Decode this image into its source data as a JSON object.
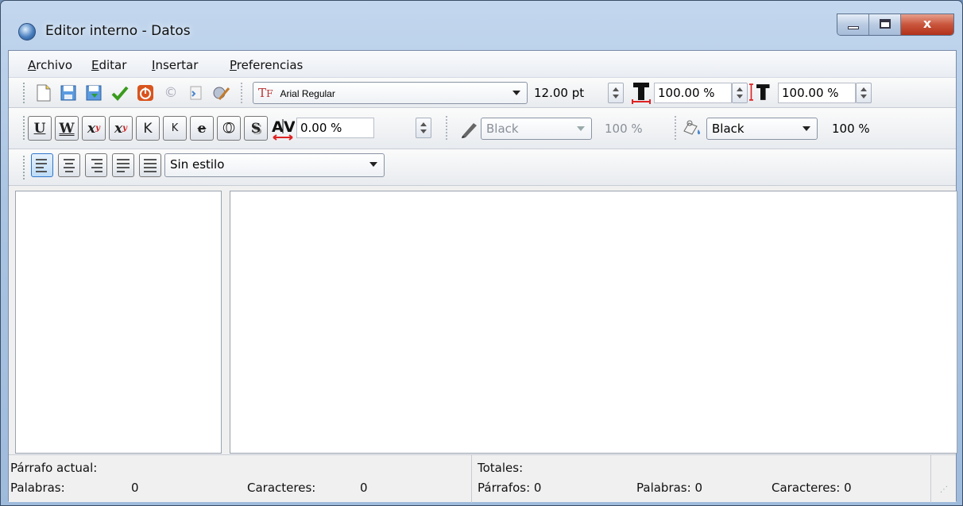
{
  "window": {
    "title": "Editor interno - Datos",
    "controls": {
      "minimize": "minimize",
      "maximize": "maximize",
      "close": "x"
    }
  },
  "menubar": {
    "items": [
      {
        "label": "Archivo",
        "mnemonic": "A"
      },
      {
        "label": "Editar",
        "mnemonic": "E"
      },
      {
        "label": "Insertar",
        "mnemonic": "I"
      },
      {
        "label": "Preferencias",
        "mnemonic": "P"
      }
    ]
  },
  "toolbar1": {
    "icons": [
      "new-document-icon",
      "open-icon",
      "save-icon",
      "check-icon",
      "power-stop-icon",
      "copyright-icon",
      "paste-icon",
      "edit-settings-icon"
    ],
    "font_combo": {
      "value": "Arial Regular",
      "icon": "font-type-icon"
    },
    "font_size": "12.00 pt",
    "char_width_icon": "text-width-icon",
    "char_width": "100.00 %",
    "char_height_icon": "text-height-icon",
    "char_height": "100.00 %"
  },
  "toolbar2": {
    "format_buttons": [
      "underline",
      "double-underline",
      "subscript",
      "superscript",
      "small-caps",
      "small-k",
      "strikethrough",
      "outline",
      "shadow"
    ],
    "tracking_value": "0.00 %",
    "stroke_color": {
      "value": "Black",
      "opacity": "100 %",
      "disabled": true
    },
    "fill_color": {
      "value": "Black",
      "opacity": "100 %",
      "disabled": false
    }
  },
  "toolbar3": {
    "alignment_buttons": [
      "align-left",
      "align-center",
      "align-right",
      "justify",
      "justify-all"
    ],
    "style_combo": "Sin estilo"
  },
  "status": {
    "paragraph_title": "Párrafo actual:",
    "words_label": "Palabras:",
    "words_value": "0",
    "chars_label": "Caracteres:",
    "chars_value": "0",
    "totals_title": "Totales:",
    "total_paragraphs_label": "Párrafos: 0",
    "total_words_label": "Palabras: 0",
    "total_chars_label": "Caracteres: 0"
  },
  "colors": {
    "accent": "#2f76c9",
    "close_button": "#c9553c",
    "check_green": "#3a9b1c",
    "stop_orange": "#d9541e"
  }
}
